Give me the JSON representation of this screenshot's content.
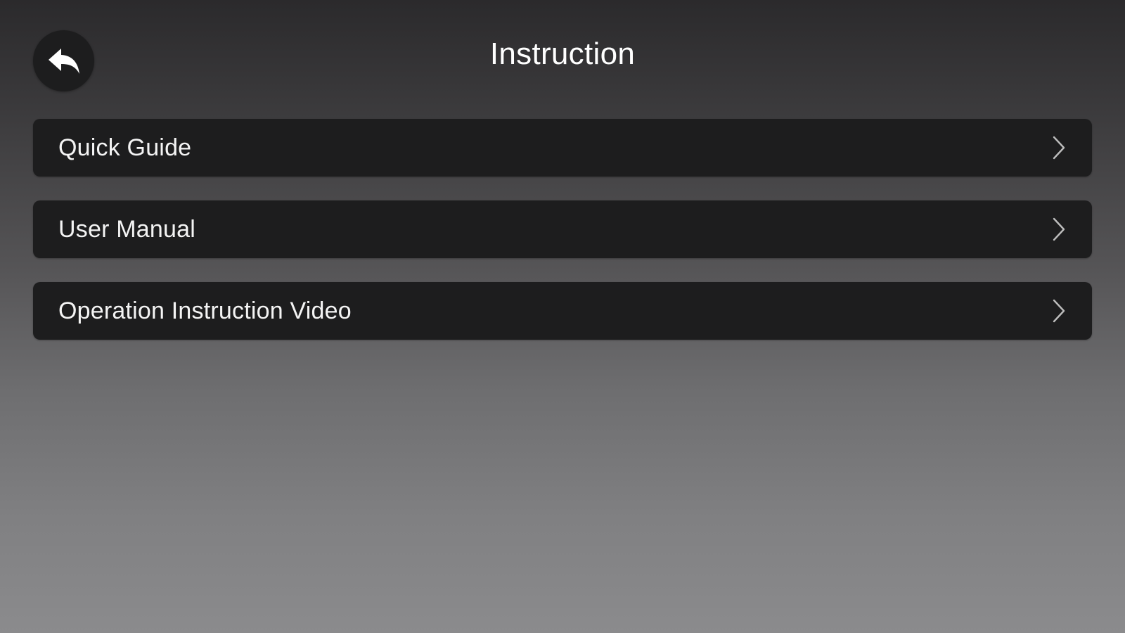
{
  "header": {
    "title": "Instruction",
    "back_icon": "back-arrow-icon"
  },
  "menu": {
    "items": [
      {
        "label": "Quick Guide",
        "icon": "chevron-right-icon"
      },
      {
        "label": "User Manual",
        "icon": "chevron-right-icon"
      },
      {
        "label": "Operation Instruction Video",
        "icon": "chevron-right-icon"
      }
    ]
  },
  "colors": {
    "background_top": "#2b2a2c",
    "background_bottom": "#8b8b8d",
    "item_background": "#1d1d1e",
    "text": "#ffffff"
  }
}
